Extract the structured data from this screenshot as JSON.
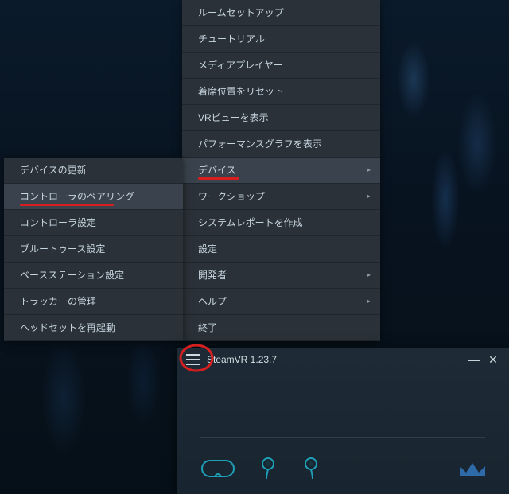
{
  "main_menu": {
    "items": [
      {
        "label": "ルームセットアップ",
        "submenu": false,
        "hl": false
      },
      {
        "label": "チュートリアル",
        "submenu": false,
        "hl": false
      },
      {
        "label": "メディアプレイヤー",
        "submenu": false,
        "hl": false
      },
      {
        "label": "着席位置をリセット",
        "submenu": false,
        "hl": false
      },
      {
        "label": "VRビューを表示",
        "submenu": false,
        "hl": false
      },
      {
        "label": "パフォーマンスグラフを表示",
        "submenu": false,
        "hl": false
      },
      {
        "label": "デバイス",
        "submenu": true,
        "hl": true,
        "ul_width": 52
      },
      {
        "label": "ワークショップ",
        "submenu": true,
        "hl": false
      },
      {
        "label": "システムレポートを作成",
        "submenu": false,
        "hl": false
      },
      {
        "label": "設定",
        "submenu": false,
        "hl": false
      },
      {
        "label": "開発者",
        "submenu": true,
        "hl": false
      },
      {
        "label": "ヘルプ",
        "submenu": true,
        "hl": false
      },
      {
        "label": "終了",
        "submenu": false,
        "hl": false
      }
    ]
  },
  "sub_menu": {
    "items": [
      {
        "label": "デバイスの更新",
        "hl": false
      },
      {
        "label": "コントローラのペアリング",
        "hl": true,
        "ul_width": 118
      },
      {
        "label": "コントローラ設定",
        "hl": false
      },
      {
        "label": "ブルートゥース設定",
        "hl": false
      },
      {
        "label": "ベースステーション設定",
        "hl": false
      },
      {
        "label": "トラッカーの管理",
        "hl": false
      },
      {
        "label": "ヘッドセットを再起動",
        "hl": false
      }
    ]
  },
  "svr": {
    "title": "SteamVR 1.23.7",
    "colors": {
      "device_outline": "#1ea0b8",
      "crown": "#2f6aa8",
      "divider": "#2f3e4b"
    }
  },
  "annotation": {
    "circle_color": "#d81f1f",
    "underline_color": "#d81f1f"
  }
}
